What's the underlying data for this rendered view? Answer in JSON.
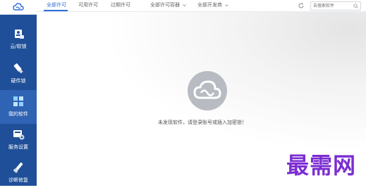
{
  "sidebar": {
    "items": [
      {
        "label": "云/软锁",
        "icon": "cloud-lock-icon",
        "active": false
      },
      {
        "label": "硬件锁",
        "icon": "usb-key-icon",
        "active": false
      },
      {
        "label": "我的软件",
        "icon": "cubes-icon",
        "active": true
      },
      {
        "label": "服务设置",
        "icon": "server-settings-icon",
        "active": false
      },
      {
        "label": "诊断修复",
        "icon": "diagnose-repair-icon",
        "active": false
      }
    ]
  },
  "tabs": [
    {
      "label": "全部许可",
      "active": true
    },
    {
      "label": "可用许可",
      "active": false
    },
    {
      "label": "过期许可",
      "active": false
    }
  ],
  "filters": {
    "container": "全部许可容器",
    "developer": "全部开发商"
  },
  "search": {
    "placeholder": "去搜索软件"
  },
  "empty_state": {
    "message": "未发现软件，请登录账号或插入加密锁！"
  },
  "watermark": "最需网",
  "colors": {
    "sidebar": "#1f4f98",
    "sidebar_active": "#2f63b3",
    "accent": "#2f6fd6",
    "watermark": "#7b2cd1"
  }
}
